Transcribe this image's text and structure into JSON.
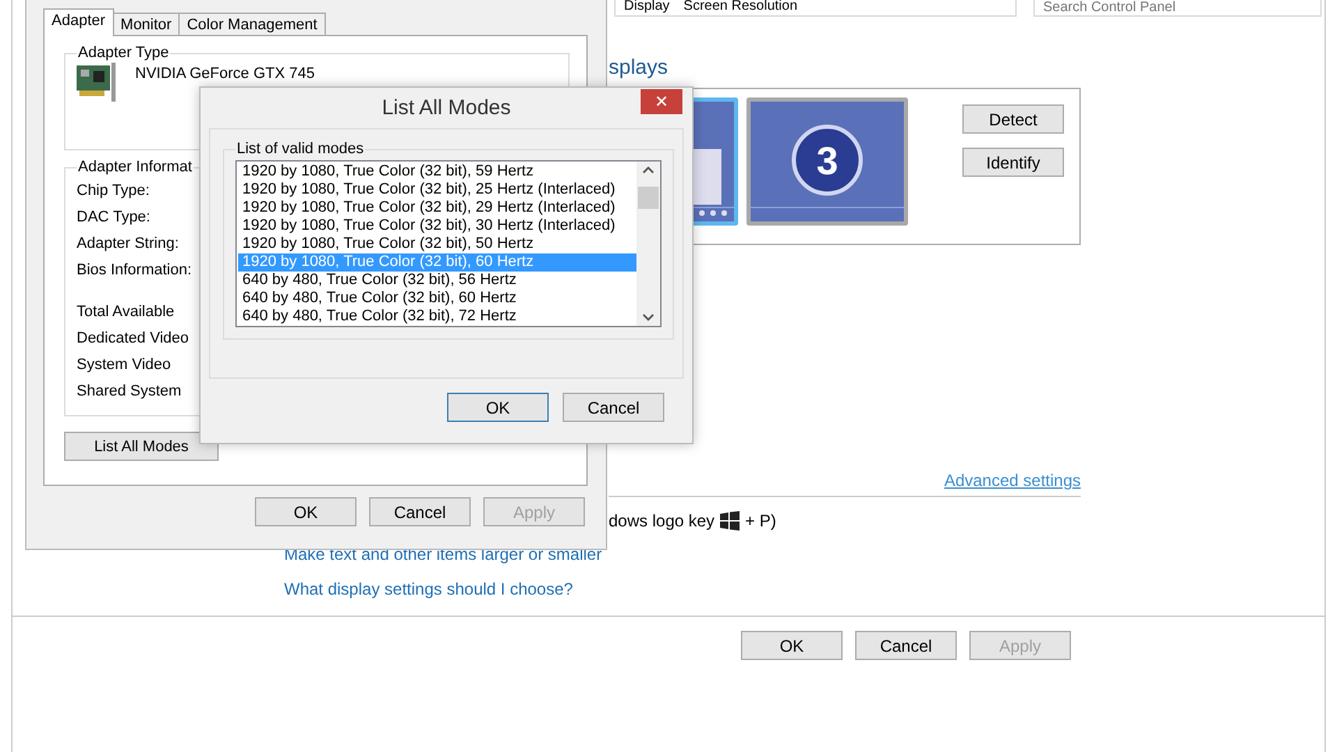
{
  "main_window": {
    "breadcrumb": [
      "Display",
      "Screen Resolution"
    ],
    "search": {
      "placeholder": "Search Control Panel"
    },
    "heading": "splays",
    "monitors": [
      {
        "selected": true
      },
      {
        "label": "3",
        "selected": false
      }
    ],
    "side_buttons": [
      "Detect",
      "Identify"
    ],
    "advanced_link": "Advanced settings",
    "shortcut_text": "dows logo key",
    "shortcut_suffix": "+ P)",
    "links": [
      "Make text and other items larger or smaller",
      "What display settings should I choose?"
    ],
    "buttons": [
      {
        "label": "OK",
        "disabled": false
      },
      {
        "label": "Cancel",
        "disabled": false
      },
      {
        "label": "Apply",
        "disabled": true
      }
    ]
  },
  "adapter_dialog": {
    "tabs": [
      {
        "label": "Adapter",
        "selected": true
      },
      {
        "label": "Monitor",
        "selected": false
      },
      {
        "label": "Color Management",
        "selected": false
      }
    ],
    "adapter_type": {
      "title": "Adapter Type",
      "name": "NVIDIA GeForce GTX 745"
    },
    "adapter_info": {
      "title": "Adapter Informat",
      "rows": [
        "Chip Type:",
        "DAC Type:",
        "Adapter String:",
        "Bios Information:"
      ],
      "memory_rows": [
        "Total Available",
        "Dedicated Video",
        "System Video",
        "Shared System"
      ]
    },
    "list_button": "List All Modes",
    "buttons": [
      {
        "label": "OK",
        "disabled": false
      },
      {
        "label": "Cancel",
        "disabled": false
      },
      {
        "label": "Apply",
        "disabled": true
      }
    ]
  },
  "modes_dialog": {
    "title": "List All Modes",
    "close": "✕",
    "group_title": "List of valid modes",
    "modes": [
      {
        "label": "1920 by 1080, True Color (32 bit), 59 Hertz",
        "selected": false
      },
      {
        "label": "1920 by 1080, True Color (32 bit), 25 Hertz (Interlaced)",
        "selected": false
      },
      {
        "label": "1920 by 1080, True Color (32 bit), 29 Hertz (Interlaced)",
        "selected": false
      },
      {
        "label": "1920 by 1080, True Color (32 bit), 30 Hertz (Interlaced)",
        "selected": false
      },
      {
        "label": "1920 by 1080, True Color (32 bit), 50 Hertz",
        "selected": false
      },
      {
        "label": "1920 by 1080, True Color (32 bit), 60 Hertz",
        "selected": true
      },
      {
        "label": "640 by 480, True Color (32 bit), 56 Hertz",
        "selected": false
      },
      {
        "label": "640 by 480, True Color (32 bit), 60 Hertz",
        "selected": false
      },
      {
        "label": "640 by 480, True Color (32 bit), 72 Hertz",
        "selected": false
      }
    ],
    "buttons": [
      {
        "label": "OK",
        "focused": true
      },
      {
        "label": "Cancel",
        "focused": false
      }
    ]
  }
}
